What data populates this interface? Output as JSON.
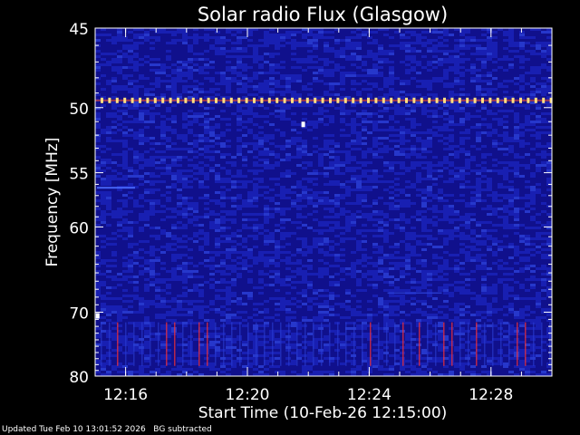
{
  "chart_data": {
    "type": "heatmap",
    "title": "Solar radio Flux (Glasgow)",
    "xlabel": "Start Time (10-Feb-26 12:15:00)",
    "ylabel": "Frequency [MHz]",
    "x_range_minutes": [
      12.25,
      12.5
    ],
    "x_start": "12:15:00",
    "x_end": "12:30:00",
    "y_range": [
      45,
      80
    ],
    "y_scale": "reciprocal",
    "x_tick_labels": [
      "12:16",
      "12:20",
      "12:24",
      "12:28"
    ],
    "x_ticks_minutes": [
      16,
      20,
      24,
      28
    ],
    "y_tick_labels": [
      "45",
      "50",
      "55",
      "60",
      "70",
      "80"
    ],
    "y_ticks": [
      45,
      50,
      55,
      60,
      70,
      80
    ],
    "colormap": [
      "#10108c",
      "#1a22b8",
      "#2a3ed6",
      "#ff3030",
      "#ffe080",
      "#ffffff"
    ],
    "features": [
      {
        "kind": "periodic-interference",
        "frequency_mhz": 49.5,
        "color": "#ffe080"
      },
      {
        "kind": "interference-band",
        "frequency_mhz_range": [
          73,
          77
        ],
        "color": "#ff3030"
      },
      {
        "kind": "bright-dot",
        "time": "12:21:50",
        "frequency_mhz": 51.2
      },
      {
        "kind": "bright-dot",
        "time": "12:15:05",
        "frequency_mhz": 70.5
      }
    ]
  },
  "footer": {
    "updated": "Updated Tue Feb 10 13:01:52 2026",
    "note": "BG subtracted"
  }
}
